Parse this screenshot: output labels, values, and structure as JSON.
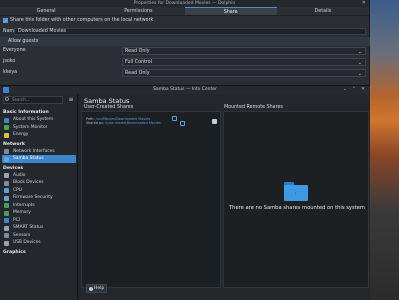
{
  "properties_window": {
    "title": "Properties for Downloaded Movies — Dolphin",
    "tabs": [
      "General",
      "Permissions",
      "Share",
      "Details"
    ],
    "active_tab": "Share",
    "share_checkbox_label": "Share this folder with other computers on the local network",
    "name_label": "Name:",
    "name_value": "Downloaded Movies",
    "allow_guests_label": "Allow guests",
    "permissions": [
      {
        "user": "Everyone",
        "access": "Read Only"
      },
      {
        "user": "jsoko",
        "access": "Full Control"
      },
      {
        "user": "kkeya",
        "access": "Read Only"
      }
    ]
  },
  "info_center": {
    "title": "Samba Status — Info Center",
    "search_placeholder": "Search...",
    "page_title": "Samba Status",
    "user_created_shares_label": "User-Created Shares",
    "mounted_remote_shares_label": "Mounted Remote Shares",
    "share_entry": {
      "path_label": "Path:",
      "path_value": "/srv/Movies/Downloaded Movies",
      "shared_as_label": "Shared as:",
      "shared_as_value": "\\\\ube-media\\Downloaded Movies"
    },
    "empty_message": "There are no Samba shares mounted on this system",
    "help_label": "Help",
    "sidebar": [
      {
        "section": "Basic Information",
        "items": [
          {
            "label": "About this System",
            "color": "#3d86cf"
          },
          {
            "label": "System Monitor",
            "color": "#4fa34f"
          },
          {
            "label": "Energy",
            "color": "#d6c33a"
          }
        ]
      },
      {
        "section": "Network",
        "items": [
          {
            "label": "Network Interfaces",
            "color": "#7b8a99"
          },
          {
            "label": "Samba Status",
            "color": "#5aa8e8",
            "active": true
          }
        ]
      },
      {
        "section": "Devices",
        "items": [
          {
            "label": "Audio",
            "color": "#9aa3ad"
          },
          {
            "label": "Block Devices",
            "color": "#7f8a94"
          },
          {
            "label": "CPU",
            "color": "#5aa0d8"
          },
          {
            "label": "Firmware Security",
            "color": "#6f9ed0"
          },
          {
            "label": "Interrupts",
            "color": "#4b9c5b"
          },
          {
            "label": "Memory",
            "color": "#4b9c5b"
          },
          {
            "label": "PCI",
            "color": "#3d86cf"
          },
          {
            "label": "SMART Status",
            "color": "#9aa3ad"
          },
          {
            "label": "Sensors",
            "color": "#7f8a94"
          },
          {
            "label": "USB Devices",
            "color": "#9aa3ad"
          }
        ]
      },
      {
        "section": "Graphics",
        "items": []
      }
    ]
  }
}
